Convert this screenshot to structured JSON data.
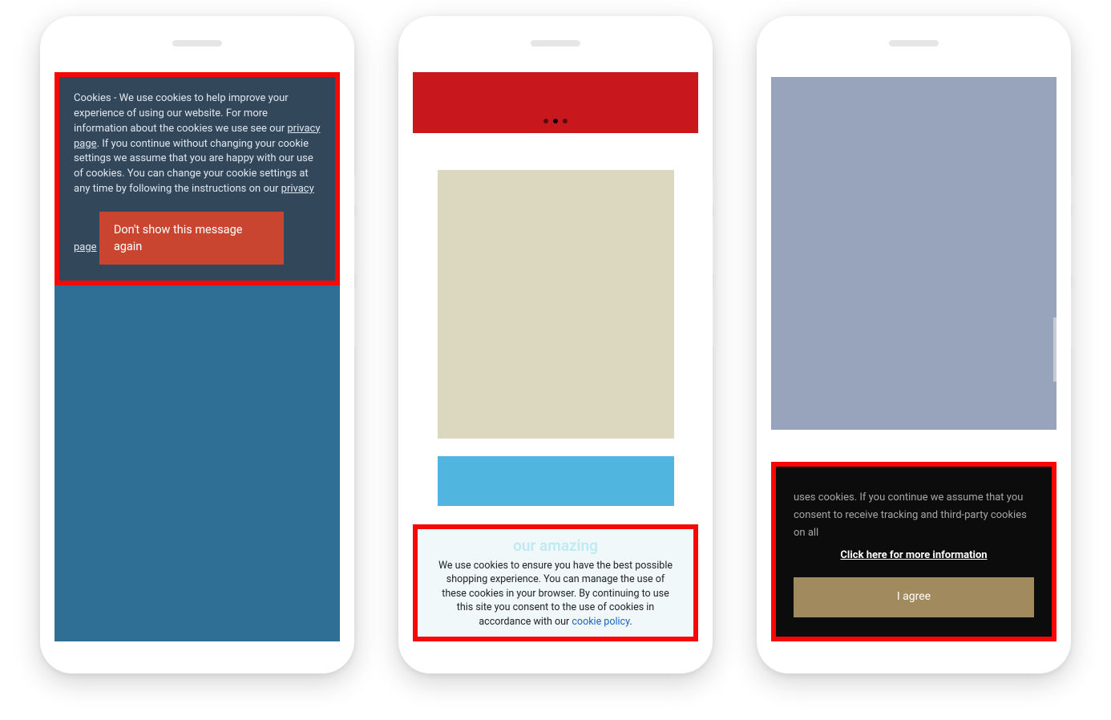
{
  "phone1": {
    "cookie_banner": {
      "text_prefix": "Cookies - We use cookies to help improve your experience of using our website. For more information about the cookies we use see our ",
      "link1": "privacy page",
      "text_mid": ". If you continue without changing your cookie settings we assume that you are happy with our use of cookies. You can change your cookie settings at any time by following the instructions on our ",
      "link2": "privacy page",
      "dismiss_button": "Don't show this message again"
    }
  },
  "phone2": {
    "ghost_text": "our amazing",
    "cookie_banner": {
      "text": "We use cookies to ensure you have the best possible shopping experience. You can manage the use of these cookies in your browser. By continuing to use this site you consent to the use of cookies in accordance with our ",
      "link": "cookie policy",
      "trailing": "."
    }
  },
  "phone3": {
    "cookie_banner": {
      "text_lead": "uses cookies. If you continue we assume that you consent to receive tracking and third-party cookies on all",
      "more_link": "Click here for more information",
      "agree_button": "I agree"
    }
  }
}
